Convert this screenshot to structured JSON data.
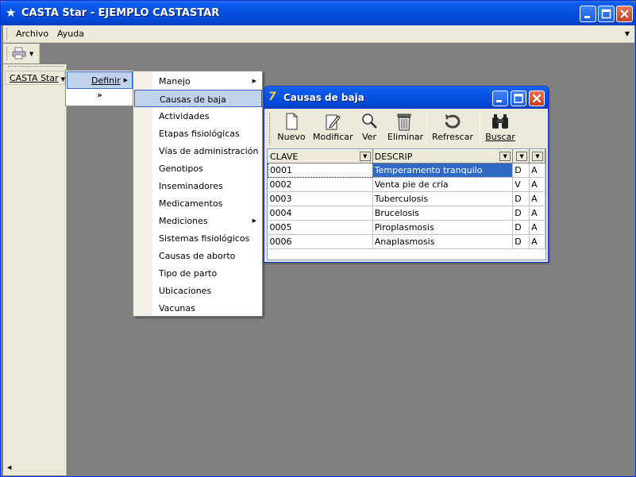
{
  "window": {
    "title": "CASTA Star - EJEMPLO CASTASTAR",
    "title_icon": "star-icon"
  },
  "menubar": {
    "items": [
      {
        "label": "Archivo"
      },
      {
        "label": "Ayuda"
      }
    ]
  },
  "toolbar": {
    "print_icon": "printer-icon"
  },
  "leftpanel": {
    "casta_label": "CASTA Star"
  },
  "definir_menu": {
    "label": "Definir",
    "more": "⌄"
  },
  "submenu": {
    "items": [
      {
        "label": "Manejo",
        "has_sub": true
      },
      {
        "label": "Causas de baja",
        "highlighted": true
      },
      {
        "label": "Actividades"
      },
      {
        "label": "Etapas fisiológicas"
      },
      {
        "label": "Vías de administración"
      },
      {
        "label": "Genotipos"
      },
      {
        "label": "Inseminadores"
      },
      {
        "label": "Medicamentos"
      },
      {
        "label": "Mediciones",
        "has_sub": true
      },
      {
        "label": "Sistemas fisiológicos"
      },
      {
        "label": "Causas de aborto"
      },
      {
        "label": "Tipo de parto"
      },
      {
        "label": "Ubicaciones"
      },
      {
        "label": "Vacunas"
      }
    ]
  },
  "child_window": {
    "title": "Causas de baja",
    "toolbar": [
      {
        "label": "Nuevo",
        "icon": "new-document-icon"
      },
      {
        "label": "Modificar",
        "icon": "edit-icon"
      },
      {
        "label": "Ver",
        "icon": "magnifier-icon"
      },
      {
        "label": "Eliminar",
        "icon": "trash-icon"
      },
      {
        "label": "Refrescar",
        "icon": "refresh-icon"
      },
      {
        "label": "Buscar",
        "icon": "binoculars-icon"
      }
    ],
    "grid": {
      "columns": [
        "CLAVE",
        "DESCRIP",
        "",
        ""
      ],
      "rows": [
        [
          "0001",
          "Temperamento tranquilo",
          "D",
          "A"
        ],
        [
          "0002",
          "Venta pie de cría",
          "V",
          "A"
        ],
        [
          "0003",
          "Tuberculosis",
          "D",
          "A"
        ],
        [
          "0004",
          "Brucelosis",
          "D",
          "A"
        ],
        [
          "0005",
          "Piroplasmosis",
          "D",
          "A"
        ],
        [
          "0006",
          "Anaplasmosis",
          "D",
          "A"
        ]
      ],
      "selected_row": 0
    }
  },
  "colors": {
    "titlebar": "#0550e0",
    "highlight": "#316ac5",
    "menu_hover": "#c1d2ee",
    "face": "#ece9d8",
    "workspace": "#808080"
  }
}
